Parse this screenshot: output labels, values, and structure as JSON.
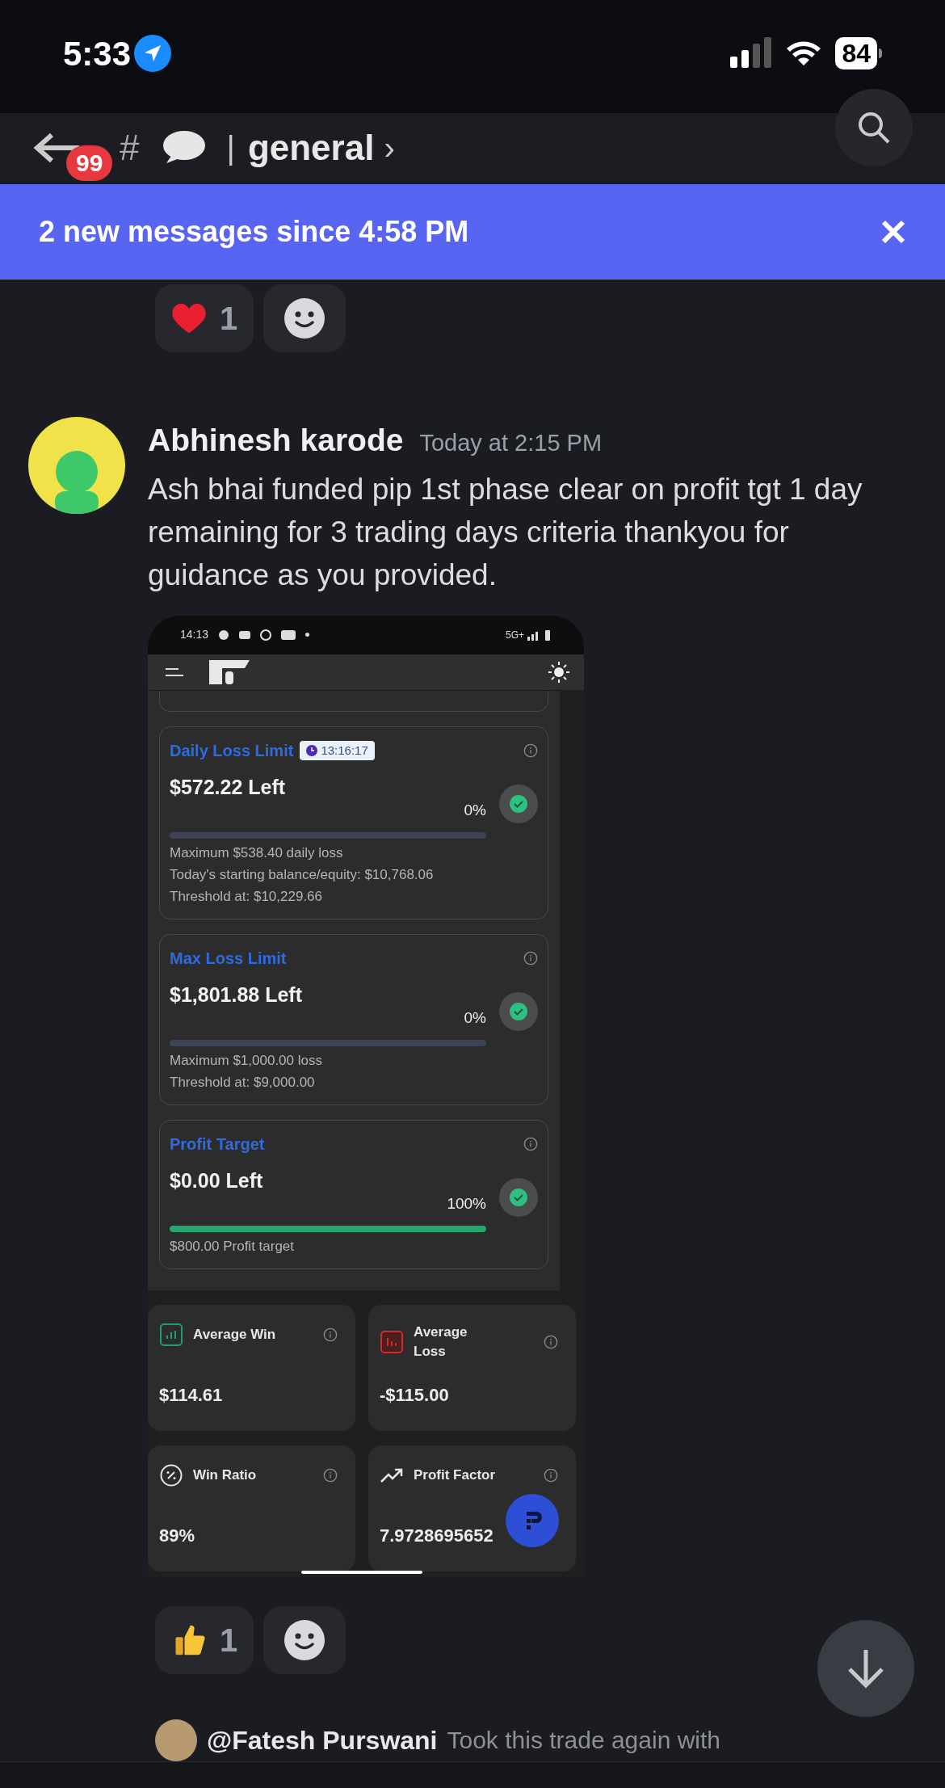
{
  "status_bar": {
    "time": "5:33",
    "battery": "84"
  },
  "header": {
    "unread_badge": "99",
    "prefix": "#",
    "separator": "|",
    "channel": "general",
    "chevron": "›"
  },
  "banner": {
    "text": "2 new messages since 4:58 PM"
  },
  "top_reactions": [
    {
      "count": "1",
      "kind": "heart"
    }
  ],
  "message": {
    "author": "Abhinesh karode",
    "timestamp": "Today at 2:15 PM",
    "text": "Ash bhai funded pip 1st phase clear on profit tgt 1 day remaining for 3 trading days criteria thankyou for guidance as you provided.",
    "attachment": {
      "phone_time": "14:13",
      "network": "5G+",
      "cards": [
        {
          "title": "Daily Loss Limit",
          "timer": "13:16:17",
          "left": "$572.22 Left",
          "percent": "0%",
          "level": 0,
          "lines": [
            "Maximum $538.40 daily loss",
            "Today's starting balance/equity: $10,768.06",
            "Threshold at: $10,229.66"
          ]
        },
        {
          "title": "Max Loss Limit",
          "left": "$1,801.88 Left",
          "percent": "0%",
          "level": 0,
          "lines": [
            "Maximum $1,000.00 loss",
            "Threshold at: $9,000.00"
          ]
        },
        {
          "title": "Profit Target",
          "left": "$0.00 Left",
          "percent": "100%",
          "level": 1,
          "lines": [
            "$800.00 Profit target"
          ]
        }
      ],
      "stats": [
        {
          "kind": "win",
          "label": "Average Win",
          "value": "$114.61"
        },
        {
          "kind": "loss",
          "label": "Average Loss",
          "value": "-$115.00"
        },
        {
          "kind": "ratio",
          "label": "Win Ratio",
          "value": "89%"
        },
        {
          "kind": "factor",
          "label": "Profit Factor",
          "value": "7.9728695652"
        }
      ]
    }
  },
  "bottom_reactions": [
    {
      "count": "1",
      "kind": "thumbs"
    }
  ],
  "next_message": {
    "mention": "@Fatesh Purswani",
    "text": "Took this trade again with"
  }
}
